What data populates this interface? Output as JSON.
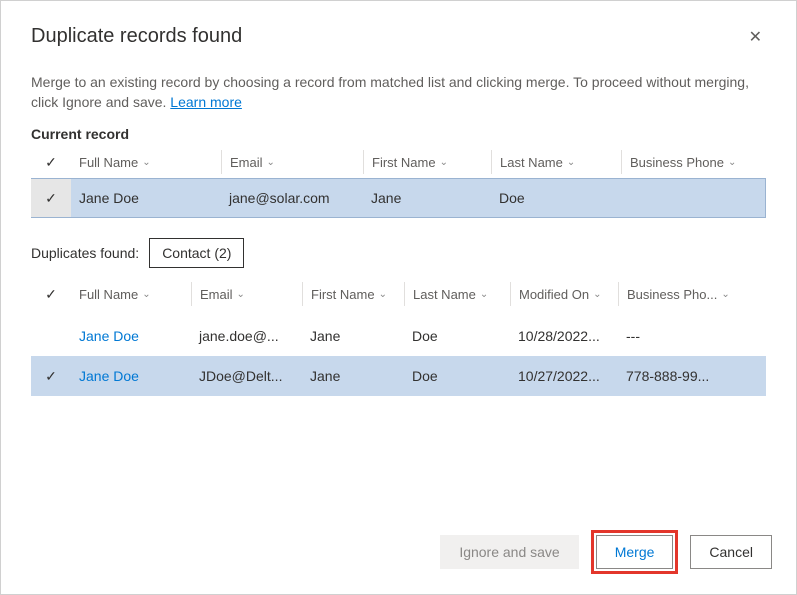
{
  "dialog": {
    "title": "Duplicate records found",
    "close_glyph": "✕",
    "description": "Merge to an existing record by choosing a record from matched list and clicking merge. To proceed without merging, click Ignore and save. ",
    "learn_more": "Learn more"
  },
  "current": {
    "section_title": "Current record",
    "columns": {
      "full_name": "Full Name",
      "email": "Email",
      "first_name": "First Name",
      "last_name": "Last Name",
      "business_phone": "Business Phone"
    },
    "record": {
      "full_name": "Jane Doe",
      "email": "jane@solar.com",
      "first_name": "Jane",
      "last_name": "Doe"
    }
  },
  "duplicates": {
    "label": "Duplicates found:",
    "chip": "Contact (2)",
    "columns": {
      "full_name": "Full Name",
      "email": "Email",
      "first_name": "First Name",
      "last_name": "Last Name",
      "modified_on": "Modified On",
      "business_phone": "Business Pho..."
    },
    "rows": [
      {
        "selected": false,
        "full_name": "Jane Doe",
        "email": "jane.doe@...",
        "first_name": "Jane",
        "last_name": "Doe",
        "modified_on": "10/28/2022...",
        "business_phone": "---"
      },
      {
        "selected": true,
        "full_name": "Jane Doe",
        "email": "JDoe@Delt...",
        "first_name": "Jane",
        "last_name": "Doe",
        "modified_on": "10/27/2022...",
        "business_phone": "778-888-99..."
      }
    ]
  },
  "footer": {
    "ignore": "Ignore and save",
    "merge": "Merge",
    "cancel": "Cancel"
  },
  "glyphs": {
    "chevron": "⌄",
    "check": "✓"
  }
}
